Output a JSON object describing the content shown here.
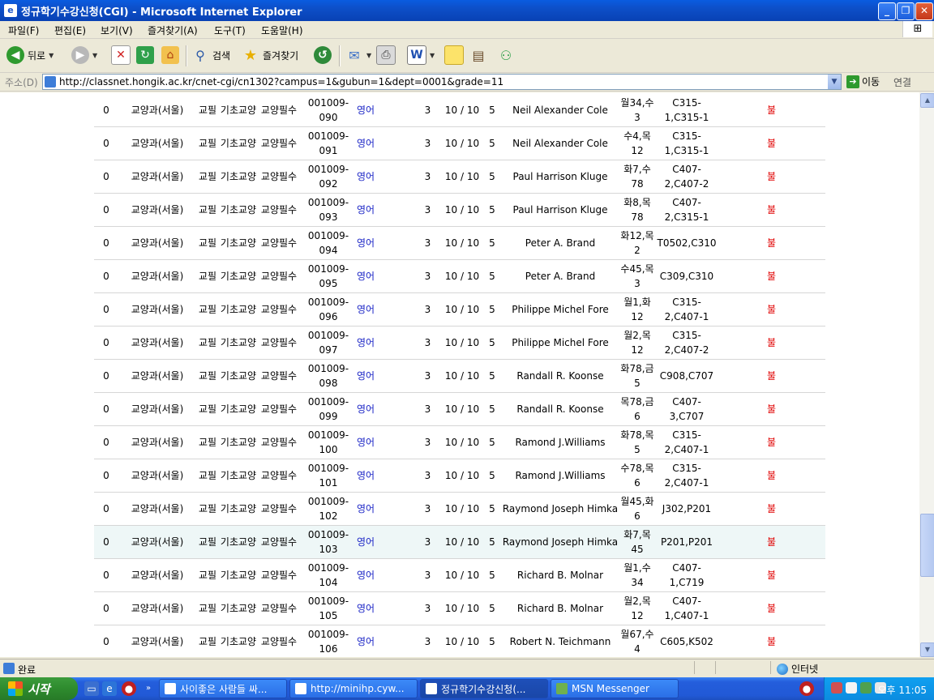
{
  "window": {
    "title": "정규학기수강신청(CGI) - Microsoft Internet Explorer",
    "app_icon": "e"
  },
  "menu": [
    "파일(F)",
    "편집(E)",
    "보기(V)",
    "즐겨찾기(A)",
    "도구(T)",
    "도움말(H)"
  ],
  "toolbar": {
    "back_label": "뒤로",
    "search_label": "검색",
    "favorites_label": "즐겨찾기"
  },
  "address": {
    "label": "주소(D)",
    "url": "http://classnet.hongik.ac.kr/cnet-cgi/cn1302?campus=1&gubun=1&dept=0001&grade=11",
    "go_label": "이동",
    "links_label": "연결"
  },
  "table": {
    "rows": [
      {
        "no": "0",
        "dept": "교양과(서울)",
        "type": "교필",
        "area": "기초교양",
        "sub": "교양필수",
        "code": "001009-090",
        "name": "영어",
        "credit": "3",
        "seats": "10 / 10",
        "num": "5",
        "prof": "Neil Alexander Cole",
        "time": "월34,수3",
        "room": "C315-1,C315-1",
        "mark": "불"
      },
      {
        "no": "0",
        "dept": "교양과(서울)",
        "type": "교필",
        "area": "기초교양",
        "sub": "교양필수",
        "code": "001009-091",
        "name": "영어",
        "credit": "3",
        "seats": "10 / 10",
        "num": "5",
        "prof": "Neil Alexander Cole",
        "time": "수4,목12",
        "room": "C315-1,C315-1",
        "mark": "불"
      },
      {
        "no": "0",
        "dept": "교양과(서울)",
        "type": "교필",
        "area": "기초교양",
        "sub": "교양필수",
        "code": "001009-092",
        "name": "영어",
        "credit": "3",
        "seats": "10 / 10",
        "num": "5",
        "prof": "Paul Harrison Kluge",
        "time": "화7,수78",
        "room": "C407-2,C407-2",
        "mark": "불"
      },
      {
        "no": "0",
        "dept": "교양과(서울)",
        "type": "교필",
        "area": "기초교양",
        "sub": "교양필수",
        "code": "001009-093",
        "name": "영어",
        "credit": "3",
        "seats": "10 / 10",
        "num": "5",
        "prof": "Paul Harrison Kluge",
        "time": "화8,목78",
        "room": "C407-2,C315-1",
        "mark": "불"
      },
      {
        "no": "0",
        "dept": "교양과(서울)",
        "type": "교필",
        "area": "기초교양",
        "sub": "교양필수",
        "code": "001009-094",
        "name": "영어",
        "credit": "3",
        "seats": "10 / 10",
        "num": "5",
        "prof": "Peter A. Brand",
        "time": "화12,목2",
        "room": "T0502,C310",
        "mark": "불"
      },
      {
        "no": "0",
        "dept": "교양과(서울)",
        "type": "교필",
        "area": "기초교양",
        "sub": "교양필수",
        "code": "001009-095",
        "name": "영어",
        "credit": "3",
        "seats": "10 / 10",
        "num": "5",
        "prof": "Peter A. Brand",
        "time": "수45,목3",
        "room": "C309,C310",
        "mark": "불"
      },
      {
        "no": "0",
        "dept": "교양과(서울)",
        "type": "교필",
        "area": "기초교양",
        "sub": "교양필수",
        "code": "001009-096",
        "name": "영어",
        "credit": "3",
        "seats": "10 / 10",
        "num": "5",
        "prof": "Philippe Michel Fore",
        "time": "월1,화12",
        "room": "C315-2,C407-1",
        "mark": "불"
      },
      {
        "no": "0",
        "dept": "교양과(서울)",
        "type": "교필",
        "area": "기초교양",
        "sub": "교양필수",
        "code": "001009-097",
        "name": "영어",
        "credit": "3",
        "seats": "10 / 10",
        "num": "5",
        "prof": "Philippe Michel Fore",
        "time": "월2,목12",
        "room": "C315-2,C407-2",
        "mark": "불"
      },
      {
        "no": "0",
        "dept": "교양과(서울)",
        "type": "교필",
        "area": "기초교양",
        "sub": "교양필수",
        "code": "001009-098",
        "name": "영어",
        "credit": "3",
        "seats": "10 / 10",
        "num": "5",
        "prof": "Randall R. Koonse",
        "time": "화78,금5",
        "room": "C908,C707",
        "mark": "불"
      },
      {
        "no": "0",
        "dept": "교양과(서울)",
        "type": "교필",
        "area": "기초교양",
        "sub": "교양필수",
        "code": "001009-099",
        "name": "영어",
        "credit": "3",
        "seats": "10 / 10",
        "num": "5",
        "prof": "Randall R. Koonse",
        "time": "목78,금6",
        "room": "C407-3,C707",
        "mark": "불"
      },
      {
        "no": "0",
        "dept": "교양과(서울)",
        "type": "교필",
        "area": "기초교양",
        "sub": "교양필수",
        "code": "001009-100",
        "name": "영어",
        "credit": "3",
        "seats": "10 / 10",
        "num": "5",
        "prof": "Ramond J.Williams",
        "time": "화78,목5",
        "room": "C315-2,C407-1",
        "mark": "불"
      },
      {
        "no": "0",
        "dept": "교양과(서울)",
        "type": "교필",
        "area": "기초교양",
        "sub": "교양필수",
        "code": "001009-101",
        "name": "영어",
        "credit": "3",
        "seats": "10 / 10",
        "num": "5",
        "prof": "Ramond J.Williams",
        "time": "수78,목6",
        "room": "C315-2,C407-1",
        "mark": "불"
      },
      {
        "no": "0",
        "dept": "교양과(서울)",
        "type": "교필",
        "area": "기초교양",
        "sub": "교양필수",
        "code": "001009-102",
        "name": "영어",
        "credit": "3",
        "seats": "10 / 10",
        "num": "5",
        "prof": "Raymond Joseph Himka",
        "time": "월45,화6",
        "room": "J302,P201",
        "mark": "불"
      },
      {
        "no": "0",
        "dept": "교양과(서울)",
        "type": "교필",
        "area": "기초교양",
        "sub": "교양필수",
        "code": "001009-103",
        "name": "영어",
        "credit": "3",
        "seats": "10 / 10",
        "num": "5",
        "prof": "Raymond Joseph Himka",
        "time": "화7,목45",
        "room": "P201,P201",
        "mark": "불"
      },
      {
        "no": "0",
        "dept": "교양과(서울)",
        "type": "교필",
        "area": "기초교양",
        "sub": "교양필수",
        "code": "001009-104",
        "name": "영어",
        "credit": "3",
        "seats": "10 / 10",
        "num": "5",
        "prof": "Richard B. Molnar",
        "time": "월1,수34",
        "room": "C407-1,C719",
        "mark": "불"
      },
      {
        "no": "0",
        "dept": "교양과(서울)",
        "type": "교필",
        "area": "기초교양",
        "sub": "교양필수",
        "code": "001009-105",
        "name": "영어",
        "credit": "3",
        "seats": "10 / 10",
        "num": "5",
        "prof": "Richard B. Molnar",
        "time": "월2,목12",
        "room": "C407-1,C407-1",
        "mark": "불"
      },
      {
        "no": "0",
        "dept": "교양과(서울)",
        "type": "교필",
        "area": "기초교양",
        "sub": "교양필수",
        "code": "001009-106",
        "name": "영어",
        "credit": "3",
        "seats": "10 / 10",
        "num": "5",
        "prof": "Robert N. Teichmann",
        "time": "월67,수4",
        "room": "C605,K502",
        "mark": "불"
      }
    ]
  },
  "status": {
    "text": "완료",
    "zone": "인터넷"
  },
  "taskbar": {
    "start_label": "시작",
    "tasks": [
      "사이좋은 사람들 싸...",
      "http://minihp.cyw...",
      "정규학기수강신청(...",
      "MSN Messenger"
    ],
    "clock": "오후 11:05"
  },
  "colors": {
    "title_bar": "#0841B4",
    "link_blue": "#1C26C6",
    "mark_red": "#E00000",
    "row_highlight": "#EEF7F7"
  }
}
